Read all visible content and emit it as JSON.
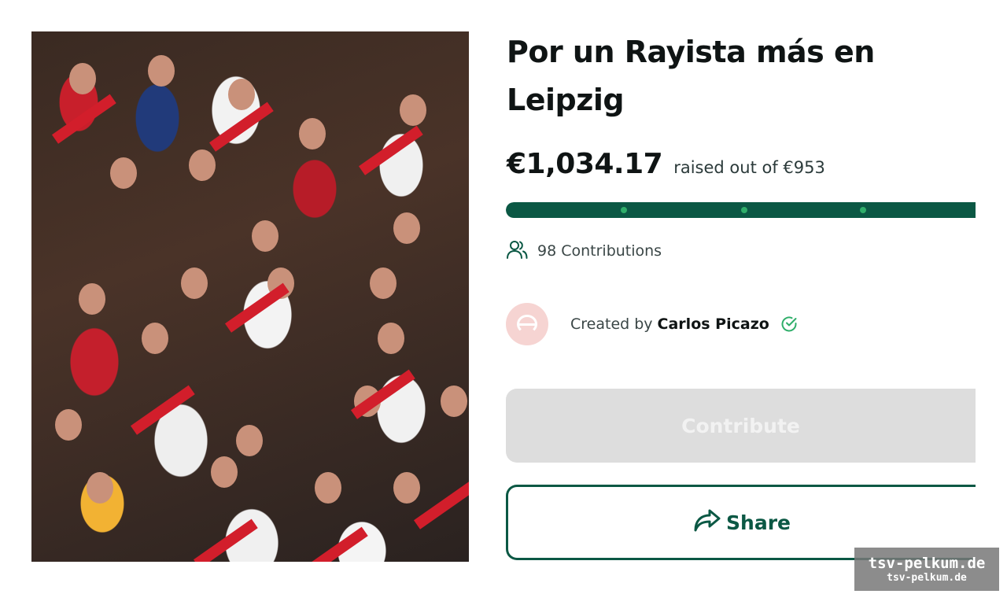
{
  "campaign": {
    "title": "Por un Rayista más en Leipzig",
    "amount_raised": "€1,034.17",
    "raised_text": "raised out of €953",
    "progress_fraction": 1.0,
    "contributions_text": "98 Contributions",
    "created_by_label": "Created by",
    "creator_name": "Carlos Picazo"
  },
  "buttons": {
    "contribute_label": "Contribute",
    "share_label": "Share"
  },
  "icons": {
    "contributors": "users-icon",
    "verified": "check-circle-icon",
    "share": "share-arrow-icon"
  },
  "colors": {
    "brand_green": "#0b5844",
    "milestone_green": "#2fae6a",
    "disabled_button": "#dddddd",
    "avatar_bg": "#f6d4d2"
  },
  "watermark": {
    "main": "tsv-pelkum.de",
    "sub": "tsv-pelkum.de"
  }
}
